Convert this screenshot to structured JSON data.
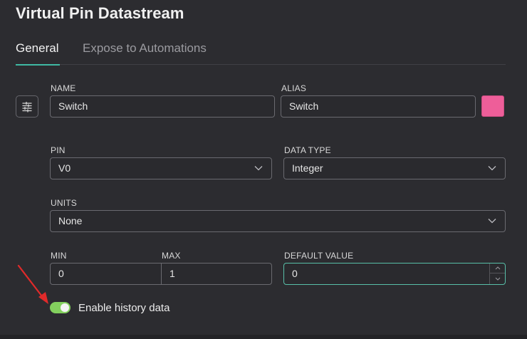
{
  "title": "Virtual Pin Datastream",
  "tabs": [
    {
      "label": "General",
      "active": true
    },
    {
      "label": "Expose to Automations",
      "active": false
    }
  ],
  "name": {
    "label": "NAME",
    "value": "Switch"
  },
  "alias": {
    "label": "ALIAS",
    "value": "Switch"
  },
  "color": {
    "value": "#ee5e99"
  },
  "pin": {
    "label": "PIN",
    "value": "V0"
  },
  "data_type": {
    "label": "DATA TYPE",
    "value": "Integer"
  },
  "units": {
    "label": "UNITS",
    "value": "None"
  },
  "min": {
    "label": "MIN",
    "value": "0"
  },
  "max": {
    "label": "MAX",
    "value": "1"
  },
  "default_value": {
    "label": "DEFAULT VALUE",
    "value": "0"
  },
  "history": {
    "label": "Enable history data",
    "enabled": true
  },
  "accent_color": "#3fb9a3",
  "toggle_color": "#83d05e",
  "annotation_color": "#e02a2a"
}
